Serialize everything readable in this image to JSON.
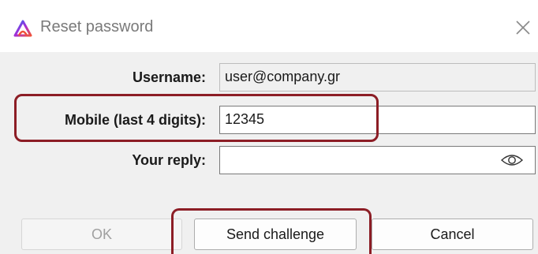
{
  "window": {
    "title": "Reset password",
    "app_icon": "app-logo-icon",
    "close_icon": "close-icon"
  },
  "form": {
    "username_label": "Username:",
    "username_value": "user@company.gr",
    "mobile_label": "Mobile (last 4 digits):",
    "mobile_value": "12345",
    "reply_label": "Your reply:",
    "reply_value": "",
    "reply_reveal_icon": "eye-icon"
  },
  "buttons": {
    "ok_label": "OK",
    "send_label": "Send challenge",
    "cancel_label": "Cancel"
  },
  "annotations": {
    "highlight_color": "#8c1d25"
  }
}
